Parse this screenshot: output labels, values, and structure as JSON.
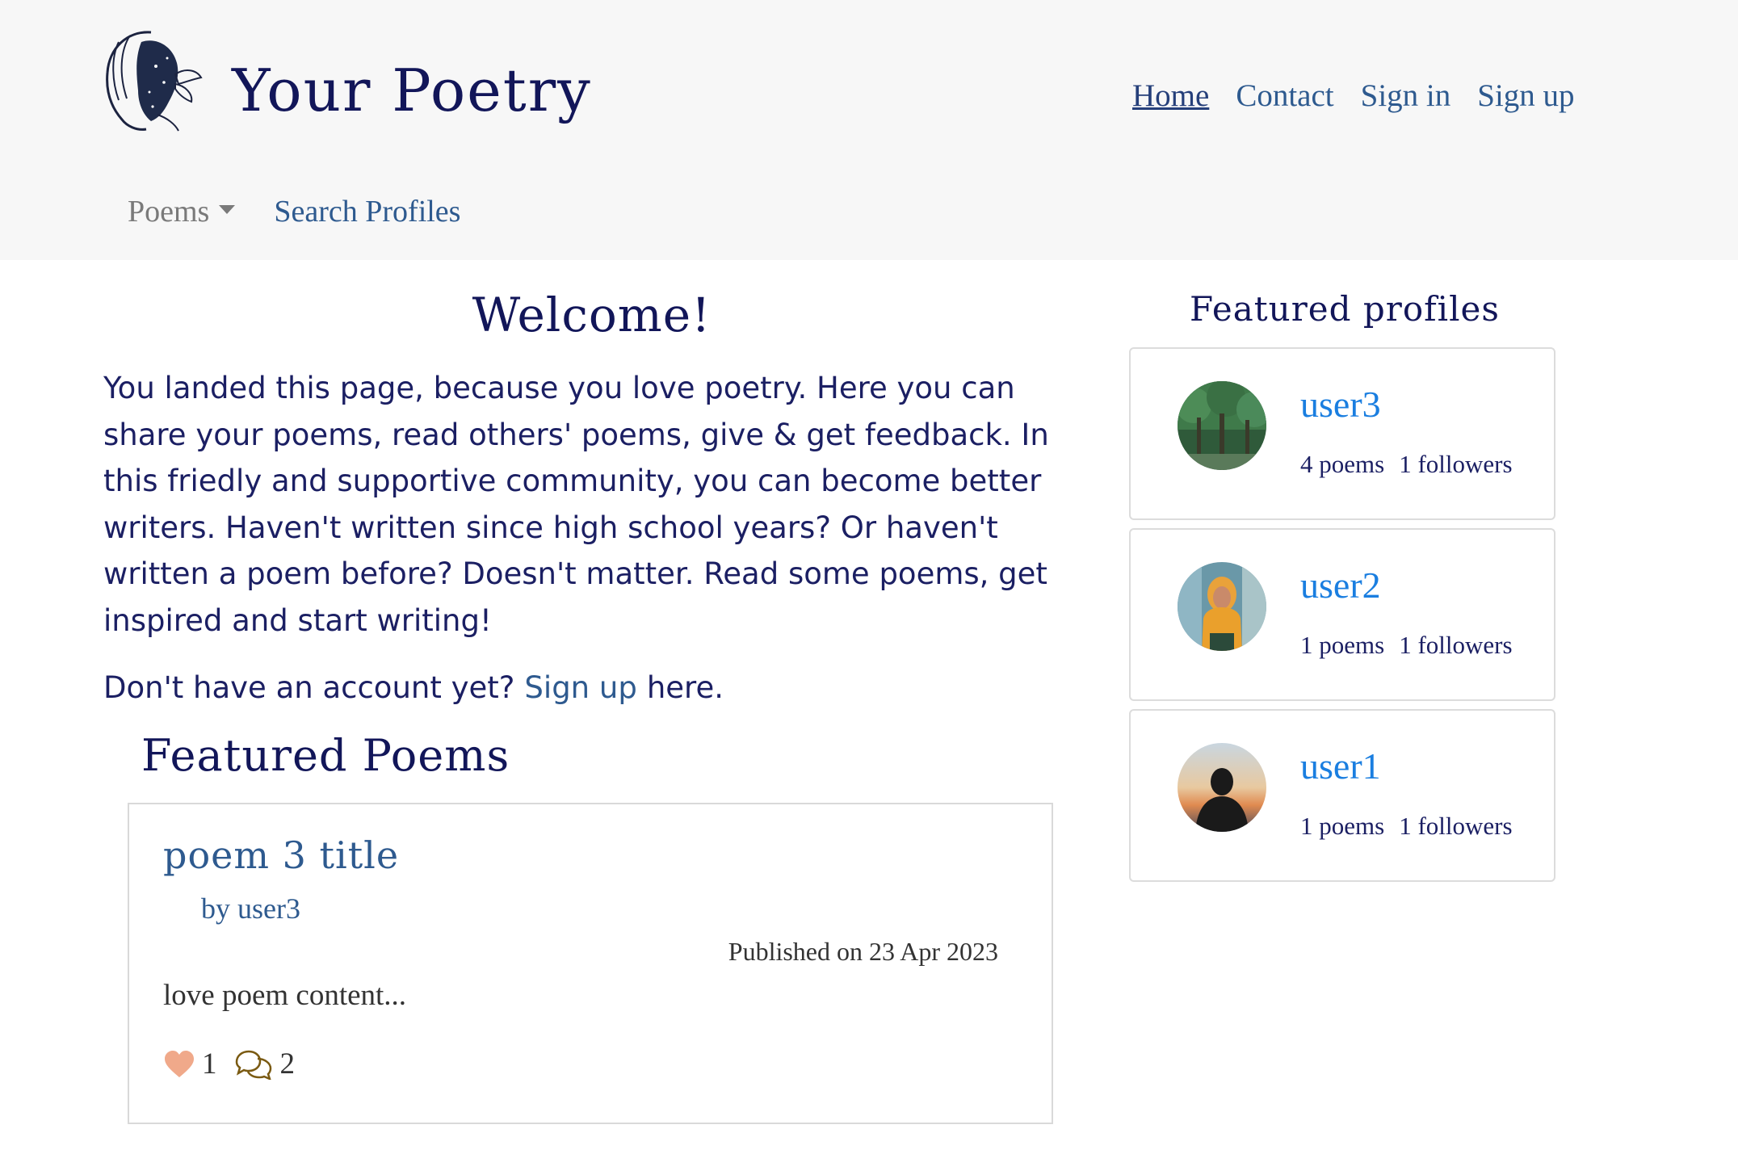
{
  "brand": {
    "name": "Your Poetry"
  },
  "nav": {
    "links": [
      {
        "label": "Home"
      },
      {
        "label": "Contact"
      },
      {
        "label": "Sign in"
      },
      {
        "label": "Sign up"
      }
    ],
    "dropdown_label": "Poems",
    "search_label": "Search Profiles"
  },
  "welcome": {
    "title": "Welcome!",
    "text": "You landed this page, because you love poetry. Here you can share your poems, read others' poems, give & get feedback. In this friedly and supportive community, you can become better writers. Haven't written since high school years? Or haven't written a poem before? Doesn't matter. Read some poems, get inspired and start writing!",
    "signup_prefix": "Don't have an account yet?",
    "signup_link": "Sign up",
    "signup_suffix": "here."
  },
  "featured_poems": {
    "title": "Featured Poems",
    "items": [
      {
        "title": "poem 3 title",
        "author": "by user3",
        "date": "Published on 23 Apr 2023",
        "excerpt": "love poem content...",
        "likes": "1",
        "comments": "2"
      }
    ]
  },
  "featured_profiles": {
    "title": "Featured profiles",
    "items": [
      {
        "name": "user3",
        "poems": "4 poems",
        "followers": "1 followers",
        "avatar": "forest-avatar"
      },
      {
        "name": "user2",
        "poems": "1 poems",
        "followers": "1 followers",
        "avatar": "woman-yellow-hoodie-avatar"
      },
      {
        "name": "user1",
        "poems": "1 poems",
        "followers": "1 followers",
        "avatar": "sunset-silhouette-avatar"
      }
    ]
  },
  "colors": {
    "navbar_bg": "#f7f7f7",
    "heading": "#121659",
    "link": "#2e5a8f",
    "profile_link": "#1a7ee0",
    "heart": "#f0a98a",
    "comment_icon": "#7a5a12"
  }
}
